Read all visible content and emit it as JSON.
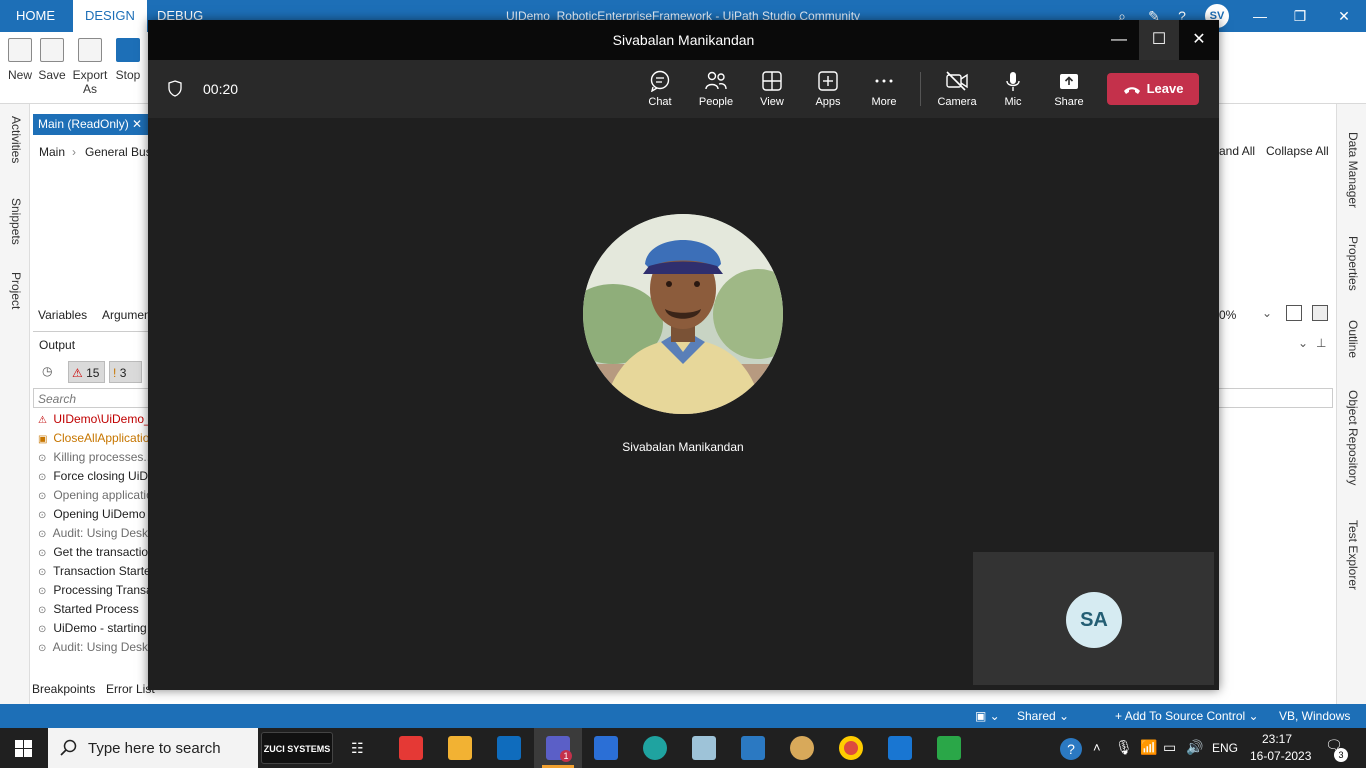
{
  "studio": {
    "menu": [
      "HOME",
      "DESIGN",
      "DEBUG"
    ],
    "title": "UIDemo_RoboticEnterpriseFramework - UiPath Studio Community",
    "user_initials": "SV",
    "ribbon": [
      "New",
      "Save",
      "Export As",
      "Stop"
    ],
    "left_panels": [
      "Activities",
      "Snippets",
      "Project"
    ],
    "right_panels": [
      "Data Manager",
      "Properties",
      "Outline",
      "Object Repository",
      "Test Explorer"
    ],
    "main_tab": "Main (ReadOnly)",
    "breadcrumb": [
      "Main",
      "General Bus"
    ],
    "expand_all": "and All",
    "collapse_all": "Collapse All",
    "designer_tabs": [
      "Variables",
      "Argumen"
    ],
    "zoom": "0%",
    "output_title": "Output",
    "error_count": "15",
    "warning_count": "3",
    "search_placeholder": "Search",
    "log_lines": [
      {
        "text": "UIDemo\\UiDemo_",
        "level": "error"
      },
      {
        "text": "CloseAllApplicatio",
        "level": "warning"
      },
      {
        "text": "Killing processes...",
        "level": "trace"
      },
      {
        "text": "Force closing UiD",
        "level": "info"
      },
      {
        "text": "Opening applicatio",
        "level": "trace"
      },
      {
        "text": "Opening UiDemo",
        "level": "info"
      },
      {
        "text": "Audit: Using Desk",
        "level": "trace"
      },
      {
        "text": "Get the transactio",
        "level": "info"
      },
      {
        "text": "Transaction Starte",
        "level": "info"
      },
      {
        "text": "Processing Transa",
        "level": "info"
      },
      {
        "text": "Started Process",
        "level": "info"
      },
      {
        "text": "UiDemo - starting",
        "level": "info"
      },
      {
        "text": "Audit: Using Desk",
        "level": "trace"
      }
    ],
    "bottom_tabs": [
      "Breakpoints",
      "Error List"
    ],
    "status": {
      "shared": "Shared",
      "source_control": "Add To Source Control",
      "language": "VB, Windows"
    }
  },
  "teams": {
    "title": "Sivabalan Manikandan",
    "timer": "00:20",
    "tools": [
      "Chat",
      "People",
      "View",
      "Apps",
      "More",
      "Camera",
      "Mic",
      "Share"
    ],
    "leave": "Leave",
    "participant_name": "Sivabalan Manikandan",
    "self_initials": "SA"
  },
  "taskbar": {
    "search_placeholder": "Type here to search",
    "zuci_logo": "ZUCI SYSTEMS",
    "language": "ENG",
    "time": "23:17",
    "date": "16-07-2023",
    "notifications": "3",
    "teams_badge": "1"
  },
  "colors": {
    "studio_blue": "#1d6fb7",
    "leave_red": "#c4314b",
    "teams_bg": "#1f1f1f"
  }
}
